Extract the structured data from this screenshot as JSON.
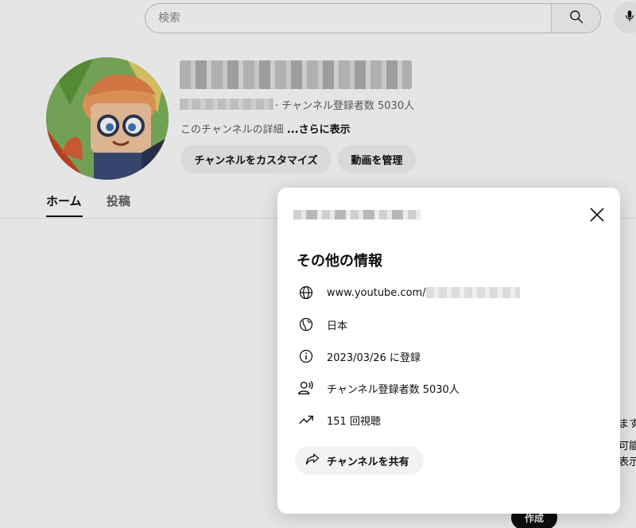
{
  "header": {
    "search_placeholder": "検索"
  },
  "channel": {
    "subscribers_text": "· チャンネル登録者数 5030人",
    "description_prefix": "このチャンネルの詳細 ",
    "description_more": "...さらに表示",
    "customize_label": "チャンネルをカスタマイズ",
    "manage_videos_label": "動画を管理"
  },
  "tabs": [
    {
      "label": "ホーム",
      "active": true
    },
    {
      "label": "投稿",
      "active": false
    }
  ],
  "background_edge": {
    "line1": "ます",
    "line2": "可能",
    "line3": "表示",
    "create_label": "作成"
  },
  "dialog": {
    "heading": "その他の情報",
    "rows": [
      {
        "icon": "globe-icon",
        "text": "www.youtube.com/"
      },
      {
        "icon": "country-globe-icon",
        "text": "日本"
      },
      {
        "icon": "info-icon",
        "text": "2023/03/26 に登録"
      },
      {
        "icon": "subscribers-icon",
        "text": "チャンネル登録者数 5030人"
      },
      {
        "icon": "trending-icon",
        "text": "151 回視聴"
      }
    ],
    "share_label": "チャンネルを共有"
  },
  "colors": {
    "text_primary": "#0f0f0f",
    "text_secondary": "#606060",
    "chip_bg": "#f2f2f2",
    "dialog_bg": "#ffffff"
  }
}
